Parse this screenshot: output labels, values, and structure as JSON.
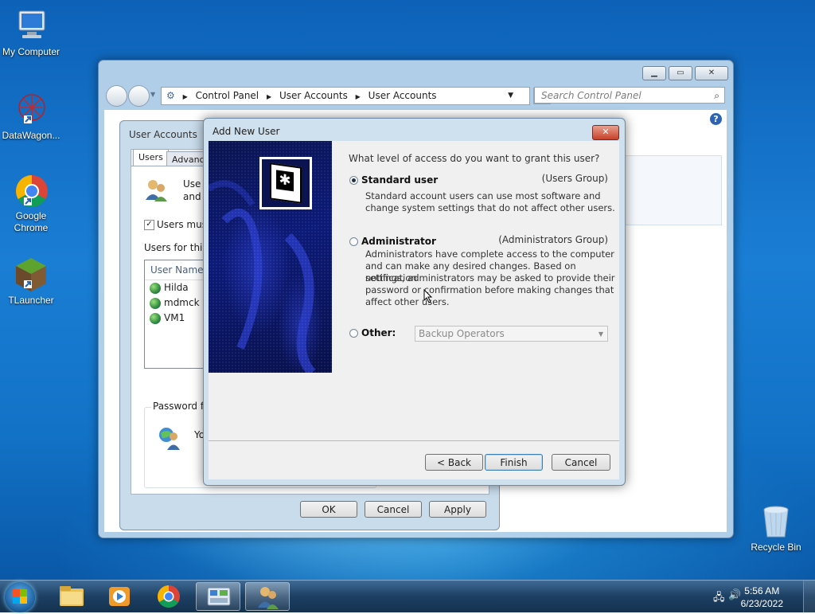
{
  "desktop": {
    "icons": [
      {
        "label": "My Computer",
        "icon": "computer-icon"
      },
      {
        "label": "DataWagon...",
        "icon": "datawagon-icon"
      },
      {
        "label": "Google Chrome",
        "icon": "chrome-icon"
      },
      {
        "label": "TLauncher",
        "icon": "tlauncher-icon"
      },
      {
        "label": "Recycle Bin",
        "icon": "recycle-bin-icon"
      }
    ]
  },
  "control_panel": {
    "breadcrumb": [
      "Control Panel",
      "User Accounts",
      "User Accounts"
    ],
    "search_placeholder": "Search Control Panel",
    "help_glyph": "?"
  },
  "user_accounts": {
    "title": "User Accounts",
    "tabs": [
      "Users",
      "Advance"
    ],
    "intro_line1": "Use t",
    "intro_line2": "and t",
    "checkbox_label": "Users must",
    "users_for_label": "Users for this c",
    "list_header": "User Name",
    "users": [
      "Hilda",
      "mdmck",
      "VM1"
    ],
    "password_group_label": "Password fo",
    "password_text": "Yo",
    "buttons": {
      "ok": "OK",
      "cancel": "Cancel",
      "apply": "Apply"
    }
  },
  "add_new_user": {
    "title": "Add New User",
    "close_glyph": "✕",
    "question": "What level of access do you want to grant this user?",
    "options": [
      {
        "label": "Standard user",
        "group": "(Users Group)",
        "selected": true,
        "desc": [
          "Standard account users can use most software and",
          "change system settings that do not affect other users."
        ]
      },
      {
        "label": "Administrator",
        "group": "(Administrators Group)",
        "selected": false,
        "desc": [
          "Administrators have complete access to the computer",
          "and can make any desired changes. Based on notification",
          "settings, administrators may be asked to provide their",
          "password or confirmation before making changes that",
          "affect other users."
        ]
      },
      {
        "label": "Other:",
        "selected": false
      }
    ],
    "other_value": "Backup Operators",
    "buttons": {
      "back": "< Back",
      "finish": "Finish",
      "cancel": "Cancel"
    }
  },
  "taskbar": {
    "time": "5:56 AM",
    "date": "6/23/2022"
  }
}
